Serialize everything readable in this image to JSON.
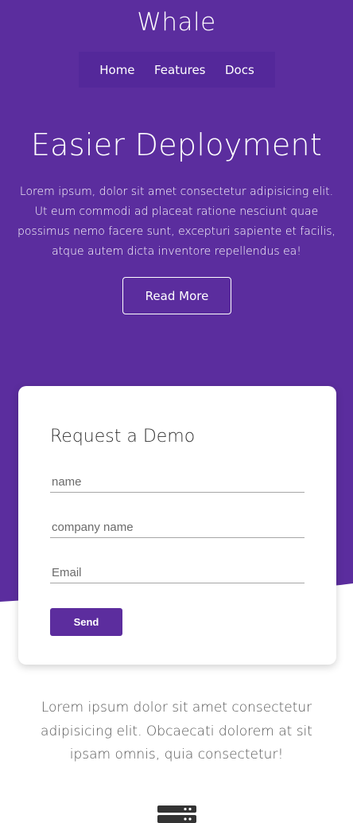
{
  "colors": {
    "hero_background": "#5b2d9e",
    "nav_background": "#54289a",
    "button": "#5c2d9e",
    "card": "#ffffff"
  },
  "header": {
    "brand": "Whale",
    "nav": [
      {
        "label": "Home"
      },
      {
        "label": "Features"
      },
      {
        "label": "Docs"
      }
    ]
  },
  "hero": {
    "title": "Easier Deployment",
    "text": "Lorem ipsum, dolor sit amet consectetur adipisicing elit. Ut eum commodi ad placeat ratione nesciunt quae possimus nemo facere sunt, excepturi sapiente et facilis, atque autem dicta inventore repellendus ea!",
    "button": "Read More"
  },
  "demo_form": {
    "title": "Request a Demo",
    "fields": [
      {
        "placeholder": "name"
      },
      {
        "placeholder": "company name"
      },
      {
        "placeholder": "Email"
      }
    ],
    "submit": "Send"
  },
  "section": {
    "text": "Lorem ipsum dolor sit amet consectetur adipisicing elit. Obcaecati dolorem at sit ipsam omnis, quia consectetur!",
    "icon": "server-icon"
  }
}
